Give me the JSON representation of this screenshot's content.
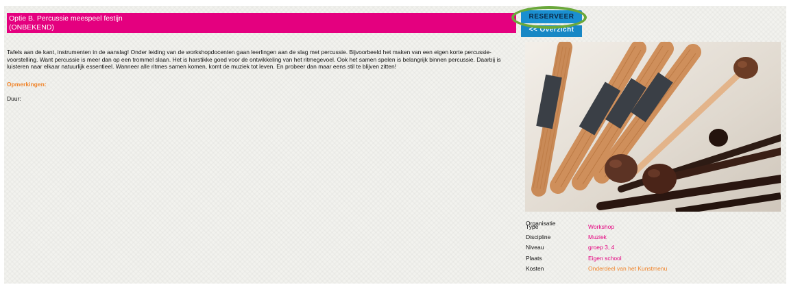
{
  "title": {
    "line1": "Optie B. Percussie meespeel festijn",
    "line2": "(ONBEKEND)"
  },
  "description": "Tafels aan de kant, instrumenten in de aanslag! Onder leiding van de workshopdocenten gaan leerlingen aan de slag met percussie. Bijvoorbeeld het maken van een eigen korte percussie-voorstelling. Want percussie is meer dan op een trommel slaan. Het is harstikke goed voor de ontwikkeling van het ritmegevoel. Ook het samen spelen is belangrijk binnen percussie. Daarbij is luisteren naar elkaar natuurlijk essentieel. Wanneer alle ritmes samen komen, komt de muziek tot leven. En probeer dan maar eens stil te blijven zitten!",
  "remarks_label": "Opmerkingen:",
  "duration_label": "Duur:",
  "buttons": {
    "reserve": "RESERVEER",
    "overview": "<< Overzicht"
  },
  "colors": {
    "title_bar": "#e4007f",
    "button": "#1787c5",
    "highlight_circle": "#6aa83b",
    "value_pink": "#e4007f",
    "value_orange": "#f0842a"
  },
  "info": {
    "organisatie_label": "Organisatie",
    "type_label": "Type",
    "type_value": "Workshop",
    "discipline_label": "Discipline",
    "discipline_value": "Muziek",
    "niveau_label": "Niveau",
    "niveau_value": "groep 3, 4",
    "plaats_label": "Plaats",
    "plaats_value": "Eigen school",
    "kosten_label": "Kosten",
    "kosten_value": "Onderdeel van het Kunstmenu"
  },
  "image": {
    "icon": "percussion-mallets-photo"
  }
}
